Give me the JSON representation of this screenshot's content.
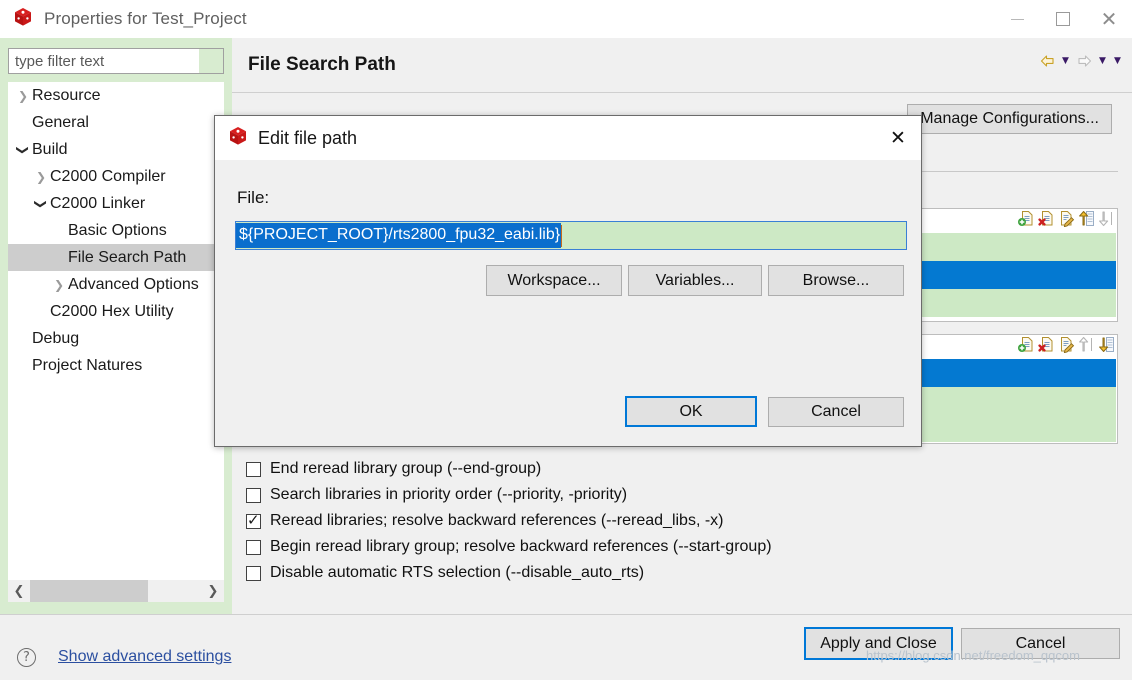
{
  "window": {
    "title": "Properties for Test_Project",
    "icon": "ccs-cube-icon",
    "minimize_label": "Minimize",
    "maximize_label": "Maximize",
    "close_label": "Close"
  },
  "sidebar": {
    "filter_placeholder": "type filter text",
    "filter_value": "",
    "items": [
      {
        "label": "Resource",
        "indent": 0,
        "twisty": "collapsed",
        "selected": false
      },
      {
        "label": "General",
        "indent": 0,
        "twisty": "none",
        "selected": false
      },
      {
        "label": "Build",
        "indent": 0,
        "twisty": "expanded",
        "selected": false
      },
      {
        "label": "C2000 Compiler",
        "indent": 1,
        "twisty": "collapsed",
        "selected": false
      },
      {
        "label": "C2000 Linker",
        "indent": 1,
        "twisty": "expanded",
        "selected": false
      },
      {
        "label": "Basic Options",
        "indent": 2,
        "twisty": "none",
        "selected": false
      },
      {
        "label": "File Search Path",
        "indent": 2,
        "twisty": "none",
        "selected": true
      },
      {
        "label": "Advanced Options",
        "indent": 2,
        "twisty": "collapsed",
        "selected": false
      },
      {
        "label": "C2000 Hex Utility",
        "indent": 1,
        "twisty": "none",
        "selected": false
      },
      {
        "label": "Debug",
        "indent": 0,
        "twisty": "none",
        "selected": false
      },
      {
        "label": "Project Natures",
        "indent": 0,
        "twisty": "none",
        "selected": false
      }
    ],
    "scroll_left_icon": "chevron-left-icon",
    "scroll_right_icon": "chevron-right-icon"
  },
  "page": {
    "title": "File Search Path",
    "nav": {
      "back_icon": "arrow-left-icon",
      "back_menu_icon": "chevron-down-icon",
      "forward_icon": "arrow-right-icon",
      "forward_menu_icon": "chevron-down-icon"
    },
    "manage_configurations_label": "Manage Configurations...",
    "list_toolbars": [
      {
        "icons": [
          "add-file-icon",
          "delete-file-icon",
          "edit-file-icon",
          "move-up-icon",
          "move-down-icon"
        ],
        "up_enabled": true,
        "down_enabled": false
      },
      {
        "icons": [
          "add-file-icon",
          "delete-file-icon",
          "edit-file-icon",
          "move-up-icon",
          "move-down-icon"
        ],
        "up_enabled": false,
        "down_enabled": true
      }
    ],
    "checkboxes": [
      {
        "label": "End reread library group (--end-group)",
        "checked": false
      },
      {
        "label": "Search libraries in priority order (--priority, -priority)",
        "checked": false
      },
      {
        "label": "Reread libraries; resolve backward references (--reread_libs, -x)",
        "checked": true
      },
      {
        "label": "Begin reread library group; resolve backward references (--start-group)",
        "checked": false
      },
      {
        "label": "Disable automatic RTS selection (--disable_auto_rts)",
        "checked": false
      }
    ]
  },
  "bottom": {
    "help_icon": "help-icon",
    "advanced_settings_label": "Show advanced settings",
    "apply_label": "Apply and Close",
    "cancel_label": "Cancel",
    "watermark": "https://blog.csdn.net/freedom_qqcom"
  },
  "dialog": {
    "icon": "ccs-cube-icon",
    "title": "Edit file path",
    "close_icon": "close-icon",
    "file_label": "File:",
    "file_value": "${PROJECT_ROOT}/rts2800_fpu32_eabi.lib}",
    "workspace_label": "Workspace...",
    "variables_label": "Variables...",
    "browse_label": "Browse...",
    "ok_label": "OK",
    "cancel_label": "Cancel"
  },
  "colors": {
    "accent_blue": "#0078d7",
    "row_selected_blue": "#0479d1",
    "row_green": "#cde9c5",
    "panel_gray": "#f0f0f0",
    "link_blue": "#2b4fa0"
  }
}
